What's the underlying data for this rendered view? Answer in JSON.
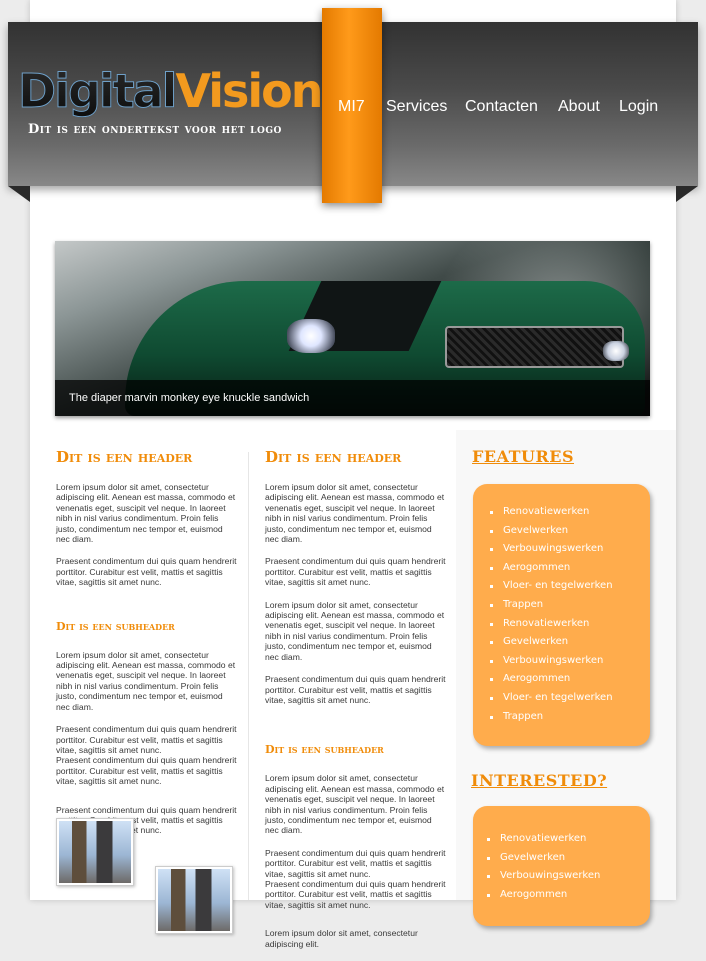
{
  "logo": {
    "brand_part1": "Digital",
    "brand_part2": "Vision",
    "tagline": "Dit is een ondertekst voor het logo"
  },
  "nav": {
    "items": [
      {
        "label": "MI7"
      },
      {
        "label": "Services"
      },
      {
        "label": "Contacten"
      },
      {
        "label": "About"
      },
      {
        "label": "Login"
      }
    ]
  },
  "banner": {
    "caption": "The diaper marvin monkey eye knuckle sandwich"
  },
  "column1": {
    "header": "Dit is een header",
    "p1": "Lorem ipsum dolor sit amet, consectetur adipiscing elit. Aenean est massa, commodo et venenatis eget, suscipit vel neque. In laoreet nibh in nisl varius condimentum. Proin felis justo, condimentum nec tempor et, euismod nec diam.",
    "p2": "Praesent condimentum dui quis quam hendrerit porttitor. Curabitur est velit, mattis et sagittis vitae, sagittis sit amet nunc.",
    "subheader": "Dit is een subheader",
    "p3": "Lorem ipsum dolor sit amet, consectetur adipiscing elit. Aenean est massa, commodo et venenatis eget, suscipit vel neque. In laoreet nibh in nisl varius condimentum. Proin felis justo, condimentum nec tempor et, euismod nec diam.",
    "p4": "Praesent condimentum dui quis quam hendrerit porttitor. Curabitur est velit, mattis et sagittis vitae, sagittis sit amet nunc.",
    "p5": "Praesent condimentum dui quis quam hendrerit porttitor. Curabitur est velit, mattis et sagittis vitae, sagittis sit amet nunc.",
    "p6": "Praesent condimentum dui quis quam hendrerit porttitor. Curabitur est velit, mattis et sagittis vitae, sagittis sit amet nunc."
  },
  "column2": {
    "header": "Dit is een header",
    "p1": "Lorem ipsum dolor sit amet, consectetur adipiscing elit. Aenean est massa, commodo et venenatis eget, suscipit vel neque. In laoreet nibh in nisl varius condimentum. Proin felis justo, condimentum nec tempor et, euismod nec diam.",
    "p2": "Praesent condimentum dui quis quam hendrerit porttitor. Curabitur est velit, mattis et sagittis vitae, sagittis sit amet nunc.",
    "p3": "Lorem ipsum dolor sit amet, consectetur adipiscing elit. Aenean est massa, commodo et venenatis eget, suscipit vel neque. In laoreet nibh in nisl varius condimentum. Proin felis justo, condimentum nec tempor et, euismod nec diam.",
    "p4": "Praesent condimentum dui quis quam hendrerit porttitor. Curabitur est velit, mattis et sagittis vitae, sagittis sit amet nunc.",
    "subheader": "Dit is een subheader",
    "p5": "Lorem ipsum dolor sit amet, consectetur adipiscing elit. Aenean est massa, commodo et venenatis eget, suscipit vel neque. In laoreet nibh in nisl varius condimentum. Proin felis justo, condimentum nec tempor et, euismod nec diam.",
    "p6": "Praesent condimentum dui quis quam hendrerit porttitor. Curabitur est velit, mattis et sagittis vitae, sagittis sit amet nunc.",
    "p7": "Praesent condimentum dui quis quam hendrerit porttitor. Curabitur est velit, mattis et sagittis vitae, sagittis sit amet nunc.",
    "p8": "Lorem ipsum dolor sit amet, consectetur adipiscing elit."
  },
  "sidebar": {
    "features_title": "FEATURES",
    "features": [
      "Renovatiewerken",
      "Gevelwerken",
      "Verbouwingswerken",
      "Aerogommen",
      "Vloer- en tegelwerken",
      "Trappen",
      "Renovatiewerken",
      "Gevelwerken",
      "Verbouwingswerken",
      "Aerogommen",
      "Vloer- en tegelwerken",
      "Trappen"
    ],
    "interested_title": "INTERESTED?",
    "interested": [
      "Renovatiewerken",
      "Gevelwerken",
      "Verbouwingswerken",
      "Aerogommen"
    ]
  },
  "colors": {
    "accent": "#f08c0a",
    "feature_box": "#ffac4c",
    "header_dark": "#3c3c3c"
  }
}
